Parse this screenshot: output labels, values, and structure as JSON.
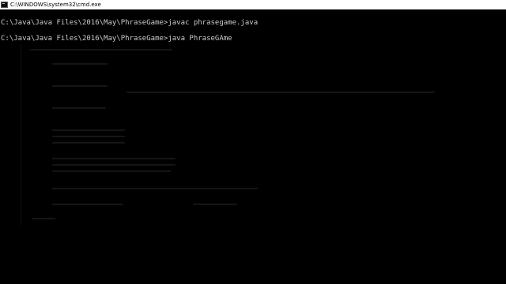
{
  "window": {
    "title": "C:\\WINDOWS\\system32\\cmd.exe",
    "icon": "console-icon"
  },
  "console": {
    "lines": [
      "C:\\Java\\Java Files\\2016\\May\\PhraseGame>javac phrasegame.java",
      "C:\\Java\\Java Files\\2016\\May\\PhraseGame>java PhraseGAme"
    ]
  }
}
